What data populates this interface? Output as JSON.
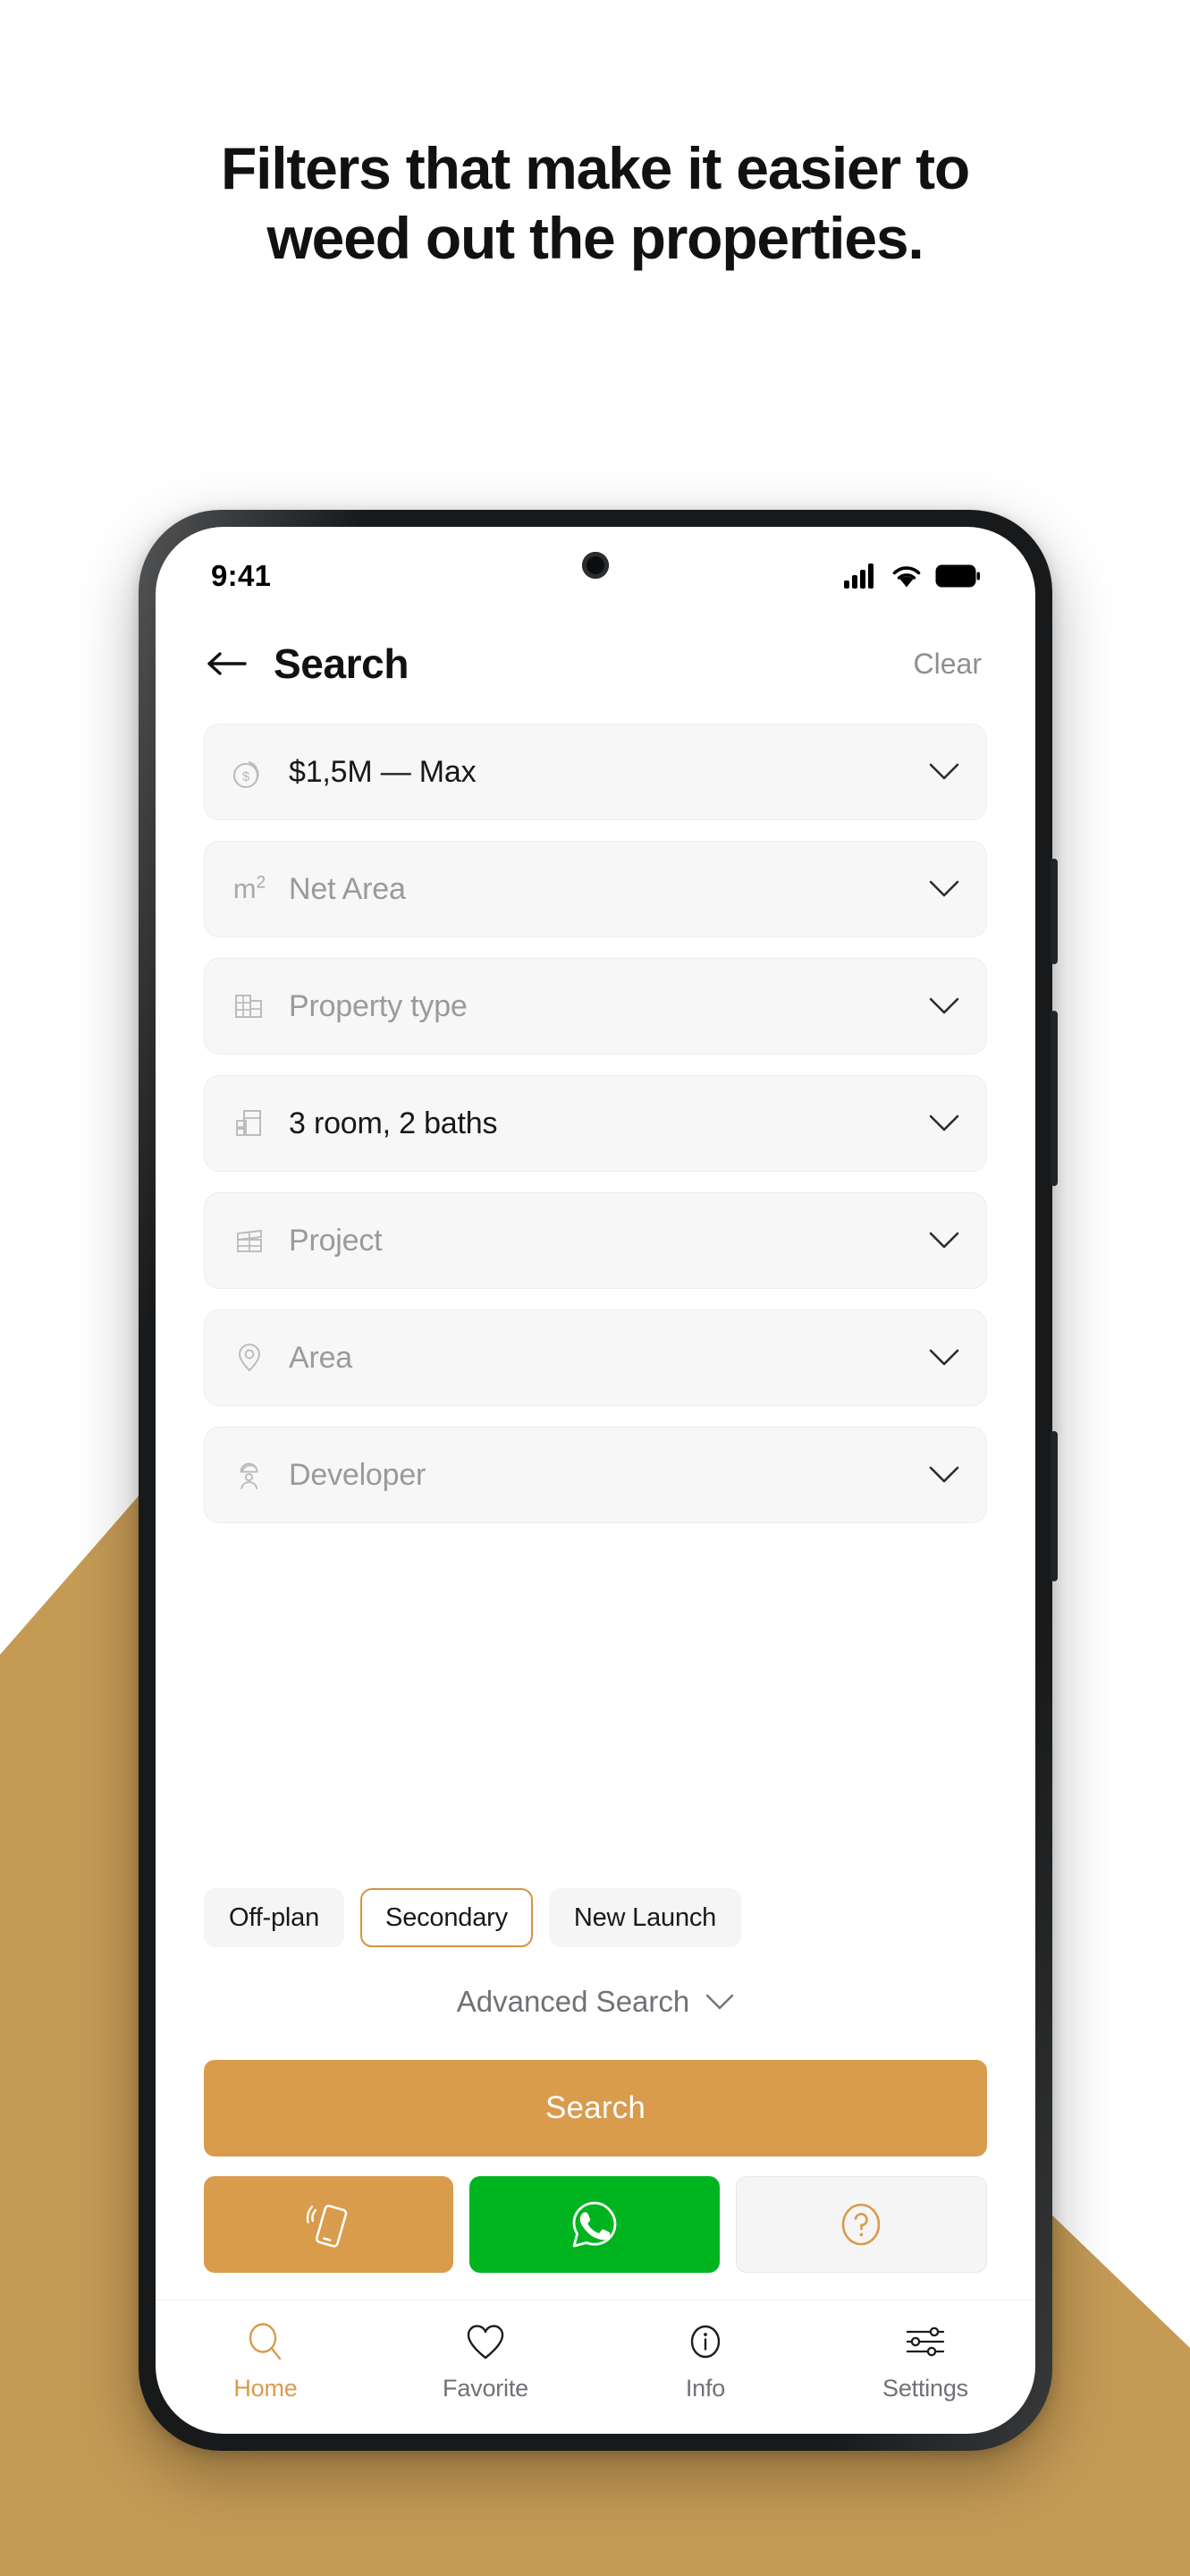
{
  "headline": {
    "line1": "Filters that make it easier to",
    "line2": "weed out the properties."
  },
  "colors": {
    "accent": "#d99b4c",
    "background_wedge": "#c49a55",
    "whatsapp_green": "#00b420",
    "page_background": "#ffffff",
    "field_background": "#f7f7f7",
    "placeholder_text": "#9a9a9a",
    "filled_text": "#16181a"
  },
  "phone": {
    "statusbar": {
      "time": "9:41",
      "icons": [
        "signal-bars-icon",
        "wifi-icon",
        "battery-icon"
      ]
    },
    "header": {
      "back_icon": "arrow-left-icon",
      "title": "Search",
      "clear_label": "Clear"
    },
    "filters": [
      {
        "icon": "coins-icon",
        "label": "$1,5M — Max",
        "filled": true
      },
      {
        "icon": "square-meter-icon",
        "label": "Net Area",
        "filled": false
      },
      {
        "icon": "building-icon",
        "label": "Property type",
        "filled": false
      },
      {
        "icon": "rooms-icon",
        "label": "3 room, 2 baths",
        "filled": true
      },
      {
        "icon": "project-grid-icon",
        "label": "Project",
        "filled": false
      },
      {
        "icon": "map-pin-icon",
        "label": "Area",
        "filled": false
      },
      {
        "icon": "developer-icon",
        "label": "Developer",
        "filled": false
      }
    ],
    "chips": [
      {
        "label": "Off-plan",
        "selected": false
      },
      {
        "label": "Secondary",
        "selected": true
      },
      {
        "label": "New Launch",
        "selected": false
      }
    ],
    "advanced_search": {
      "label": "Advanced Search",
      "icon": "chevron-down-icon"
    },
    "search_button": {
      "label": "Search"
    },
    "actions": [
      {
        "name": "call",
        "icon": "ringing-phone-icon"
      },
      {
        "name": "whatsapp",
        "icon": "whatsapp-icon"
      },
      {
        "name": "help",
        "icon": "question-circle-icon"
      }
    ],
    "tabs": [
      {
        "label": "Home",
        "icon": "search-icon",
        "active": true
      },
      {
        "label": "Favorite",
        "icon": "heart-icon",
        "active": false
      },
      {
        "label": "Info",
        "icon": "info-icon",
        "active": false
      },
      {
        "label": "Settings",
        "icon": "sliders-icon",
        "active": false
      }
    ]
  }
}
